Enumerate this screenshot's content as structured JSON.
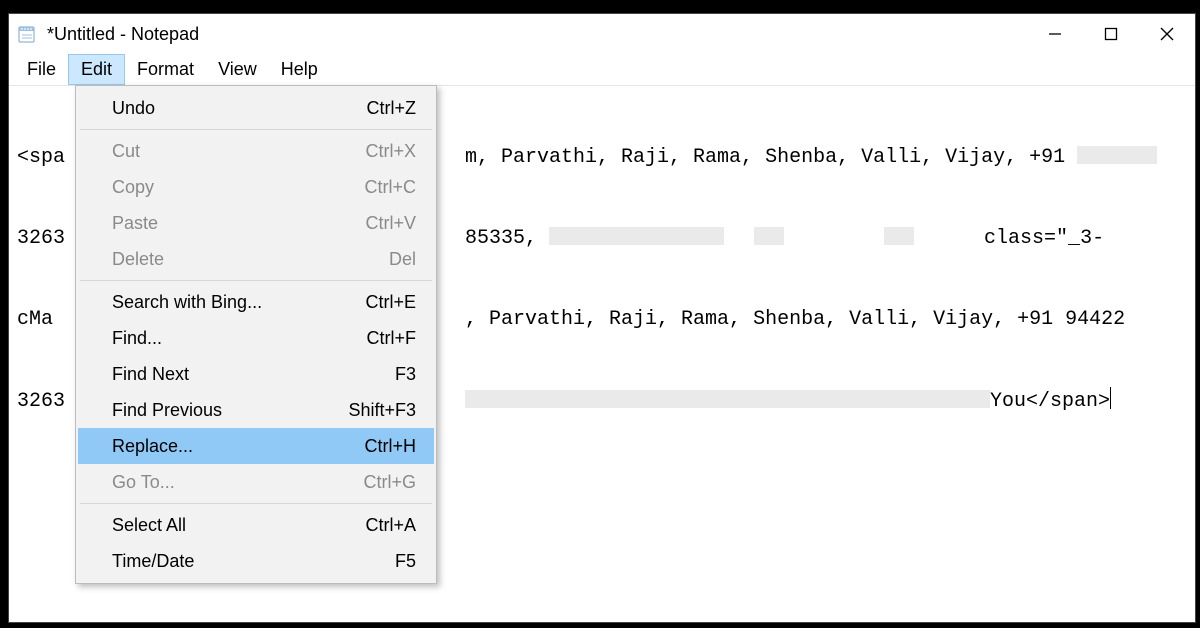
{
  "window": {
    "title": "*Untitled - Notepad"
  },
  "menubar": {
    "file": "File",
    "edit": "Edit",
    "format": "Format",
    "view": "View",
    "help": "Help"
  },
  "editMenu": {
    "undo": {
      "label": "Undo",
      "shortcut": "Ctrl+Z",
      "enabled": true
    },
    "cut": {
      "label": "Cut",
      "shortcut": "Ctrl+X",
      "enabled": false
    },
    "copy": {
      "label": "Copy",
      "shortcut": "Ctrl+C",
      "enabled": false
    },
    "paste": {
      "label": "Paste",
      "shortcut": "Ctrl+V",
      "enabled": false
    },
    "delete": {
      "label": "Delete",
      "shortcut": "Del",
      "enabled": false
    },
    "searchBing": {
      "label": "Search with Bing...",
      "shortcut": "Ctrl+E",
      "enabled": true
    },
    "find": {
      "label": "Find...",
      "shortcut": "Ctrl+F",
      "enabled": true
    },
    "findNext": {
      "label": "Find Next",
      "shortcut": "F3",
      "enabled": true
    },
    "findPrev": {
      "label": "Find Previous",
      "shortcut": "Shift+F3",
      "enabled": true
    },
    "replace": {
      "label": "Replace...",
      "shortcut": "Ctrl+H",
      "enabled": true,
      "highlight": true
    },
    "goto": {
      "label": "Go To...",
      "shortcut": "Ctrl+G",
      "enabled": false
    },
    "selectAll": {
      "label": "Select All",
      "shortcut": "Ctrl+A",
      "enabled": true
    },
    "timeDate": {
      "label": "Time/Date",
      "shortcut": "F5",
      "enabled": true
    }
  },
  "text": {
    "l1a": "<spa",
    "l1b": "m, Parvathi, Raji, Rama, Shenba, Valli, Vijay, +91 ",
    "l2a": "3263",
    "l2b": "85335",
    "l2c": ", ",
    "l2d": "class=\"_3-",
    "l3a": "cMa",
    "l3b": ", Parvathi, Raji, Rama, Shenba, Valli, Vijay, +91 94422",
    "l4a": "3263",
    "l4b": "You</span>"
  }
}
